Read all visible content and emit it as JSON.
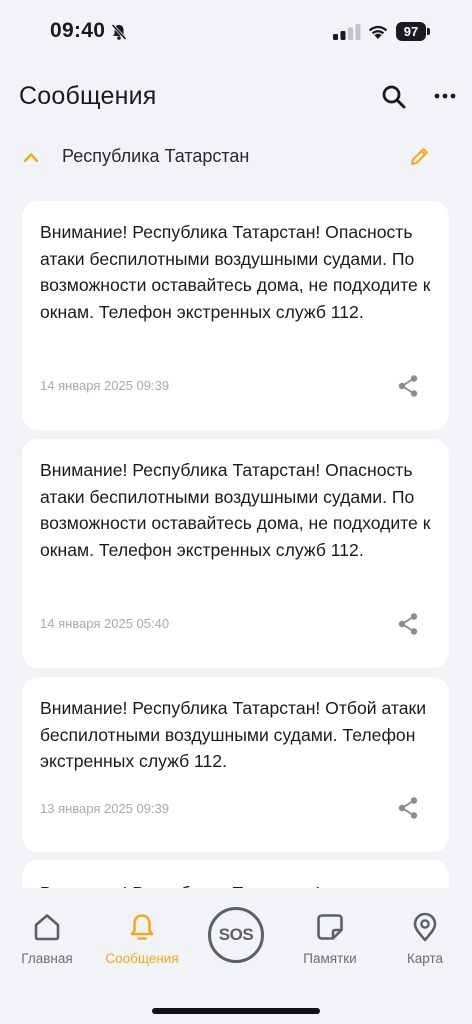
{
  "status_bar": {
    "time": "09:40",
    "battery": "97"
  },
  "header": {
    "title": "Сообщения"
  },
  "region": {
    "name": "Республика Татарстан"
  },
  "messages": [
    {
      "text": "Внимание! Республика Татарстан! Опасность атаки беспилотными воздушными судами. По возможности оставайтесь дома, не подходите к окнам. Телефон экстренных служб 112.",
      "date": "14 января 2025 09:39"
    },
    {
      "text": "Внимание! Республика Татарстан! Опасность атаки беспилотными воздушными судами. По возможности оставайтесь дома, не подходите к окнам. Телефон экстренных служб 112.",
      "date": "14 января 2025 05:40"
    },
    {
      "text": "Внимание! Республика Татарстан! Отбой атаки беспилотными воздушными судами. Телефон экстренных служб 112.",
      "date": "13 января 2025 09:39"
    },
    {
      "text": "Внимание! Республика Татарстан!"
    }
  ],
  "tabs": {
    "home": "Главная",
    "messages": "Сообщения",
    "sos": "SOS",
    "memos": "Памятки",
    "map": "Карта"
  },
  "colors": {
    "accent": "#f5a81c",
    "background": "#f2f3f6",
    "card": "#ffffff",
    "inactive_tab": "#6c6c74"
  }
}
